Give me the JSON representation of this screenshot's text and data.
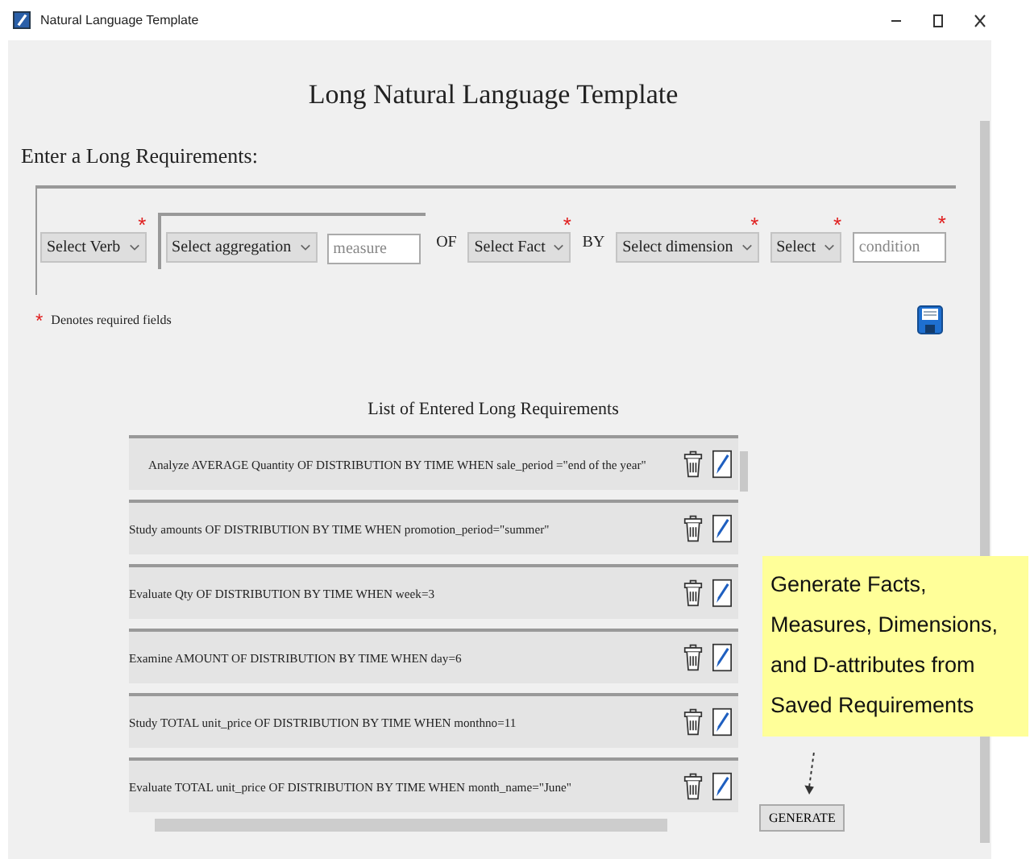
{
  "window": {
    "title": "Natural Language Template"
  },
  "heading": "Long Natural Language Template",
  "prompt": "Enter a Long Requirements:",
  "required_mark": "*",
  "form": [
    {
      "kind": "select",
      "text": "Select Verb",
      "required": true
    },
    {
      "kind": "group",
      "children": [
        {
          "kind": "select",
          "text": "Select aggregation"
        },
        {
          "kind": "input",
          "placeholder": "measure"
        }
      ]
    },
    {
      "kind": "label",
      "text": "OF"
    },
    {
      "kind": "select",
      "text": "Select Fact",
      "required": true
    },
    {
      "kind": "label",
      "text": "BY"
    },
    {
      "kind": "select",
      "text": "Select dimension",
      "required": true
    },
    {
      "kind": "select",
      "text": "Select",
      "required": true
    },
    {
      "kind": "input",
      "placeholder": "condition",
      "required": true
    }
  ],
  "legend": "Denotes required fields",
  "list_title": "List of Entered Long Requirements",
  "requirements": [
    "Analyze AVERAGE Quantity OF DISTRIBUTION BY TIME WHEN sale_period =\"end of the year\"",
    "Study amounts OF DISTRIBUTION BY TIME WHEN promotion_period=\"summer\"",
    "Evaluate Qty OF DISTRIBUTION BY TIME WHEN week=3",
    "Examine AMOUNT OF DISTRIBUTION BY TIME WHEN day=6",
    "Study TOTAL unit_price OF DISTRIBUTION BY TIME WHEN monthno=11",
    "Evaluate TOTAL unit_price OF DISTRIBUTION BY TIME WHEN month_name=\"June\""
  ],
  "generate_button": "GENERATE",
  "callout": "Generate Facts, Measures, Dimensions, and D-attributes from Saved Requirements"
}
